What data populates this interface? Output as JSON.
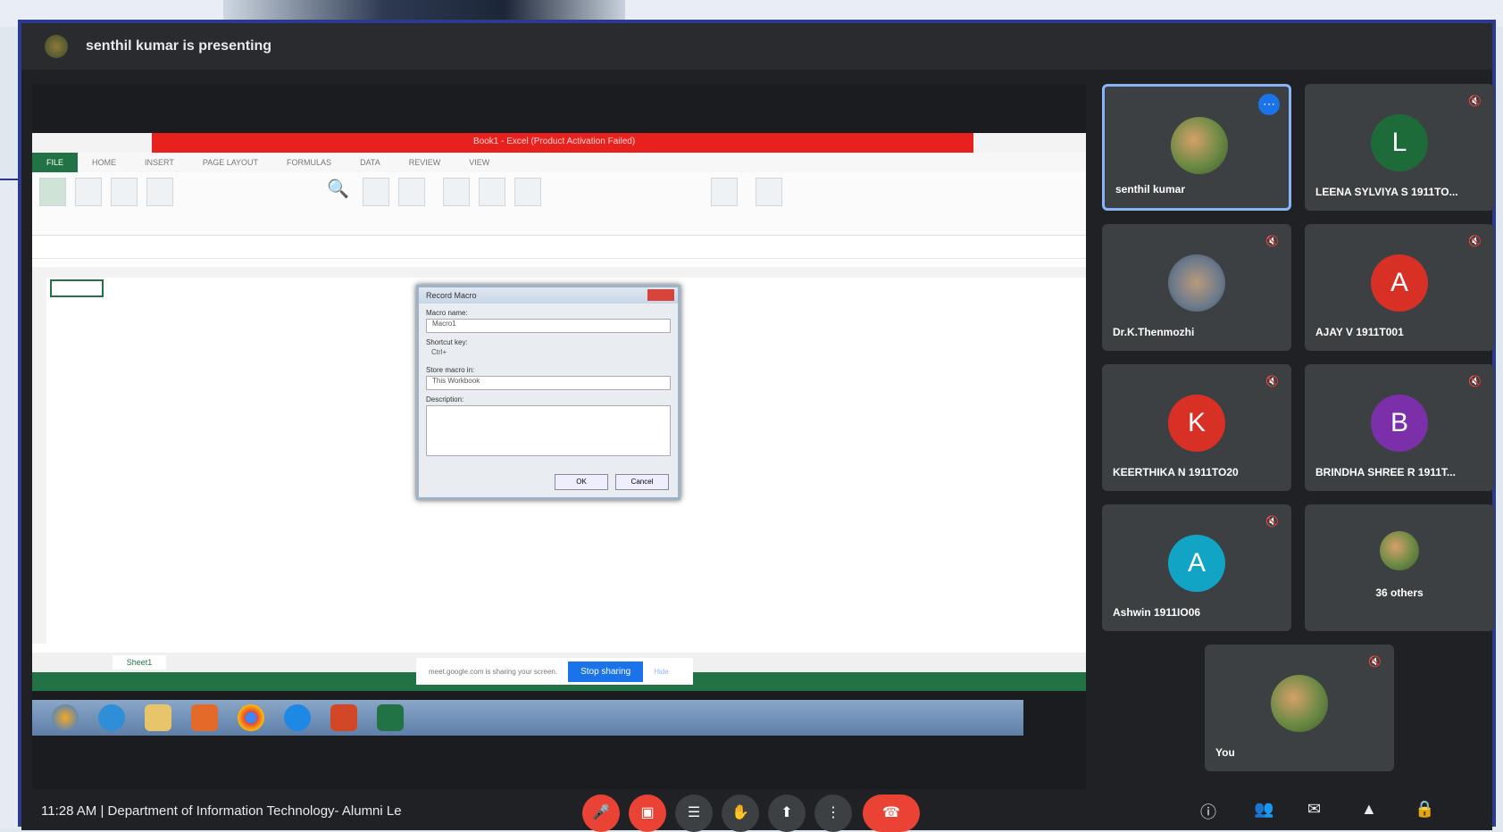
{
  "presenter_bar": {
    "text": "senthil kumar is presenting"
  },
  "excel": {
    "title": "Book1 - Excel (Product Activation Failed)",
    "tabs": [
      "FILE",
      "HOME",
      "INSERT",
      "PAGE LAYOUT",
      "FORMULAS",
      "DATA",
      "REVIEW",
      "VIEW"
    ],
    "sheet_tab": "Sheet1",
    "dialog": {
      "title": "Record Macro",
      "macro_name_label": "Macro name:",
      "macro_name_value": "Macro1",
      "shortcut_label": "Shortcut key:",
      "shortcut_value": "Ctrl+",
      "store_label": "Store macro in:",
      "store_value": "This Workbook",
      "description_label": "Description:",
      "ok": "OK",
      "cancel": "Cancel"
    },
    "share_banner": {
      "text": "meet.google.com is sharing your screen.",
      "stop": "Stop sharing",
      "hide": "Hide"
    }
  },
  "participants": [
    {
      "name": "senthil kumar",
      "initial": "",
      "color": "",
      "speaking": true
    },
    {
      "name": "LEENA SYLVIYA S 1911TO...",
      "initial": "L",
      "color": "#1e6b3a"
    },
    {
      "name": "Dr.K.Thenmozhi",
      "initial": "",
      "color": ""
    },
    {
      "name": "AJAY V 1911T001",
      "initial": "A",
      "color": "#d93025"
    },
    {
      "name": "KEERTHIKA N 1911TO20",
      "initial": "K",
      "color": "#d93025"
    },
    {
      "name": "BRINDHA SHREE R 1911T...",
      "initial": "B",
      "color": "#7b2fa8"
    },
    {
      "name": "Ashwin 1911IO06",
      "initial": "A",
      "color": "#12a4c4"
    },
    {
      "name": "36 others",
      "initial": "",
      "color": ""
    },
    {
      "name": "You",
      "initial": "",
      "color": ""
    }
  ],
  "footer": {
    "time": "11:28 AM",
    "separator": "|",
    "meeting": "Department of Information Technology- Alumni Le"
  },
  "colors": {
    "frame": "#2c3a8f",
    "accent": "#1a73e8",
    "excel_green": "#217346",
    "end_call": "#ea4335"
  }
}
